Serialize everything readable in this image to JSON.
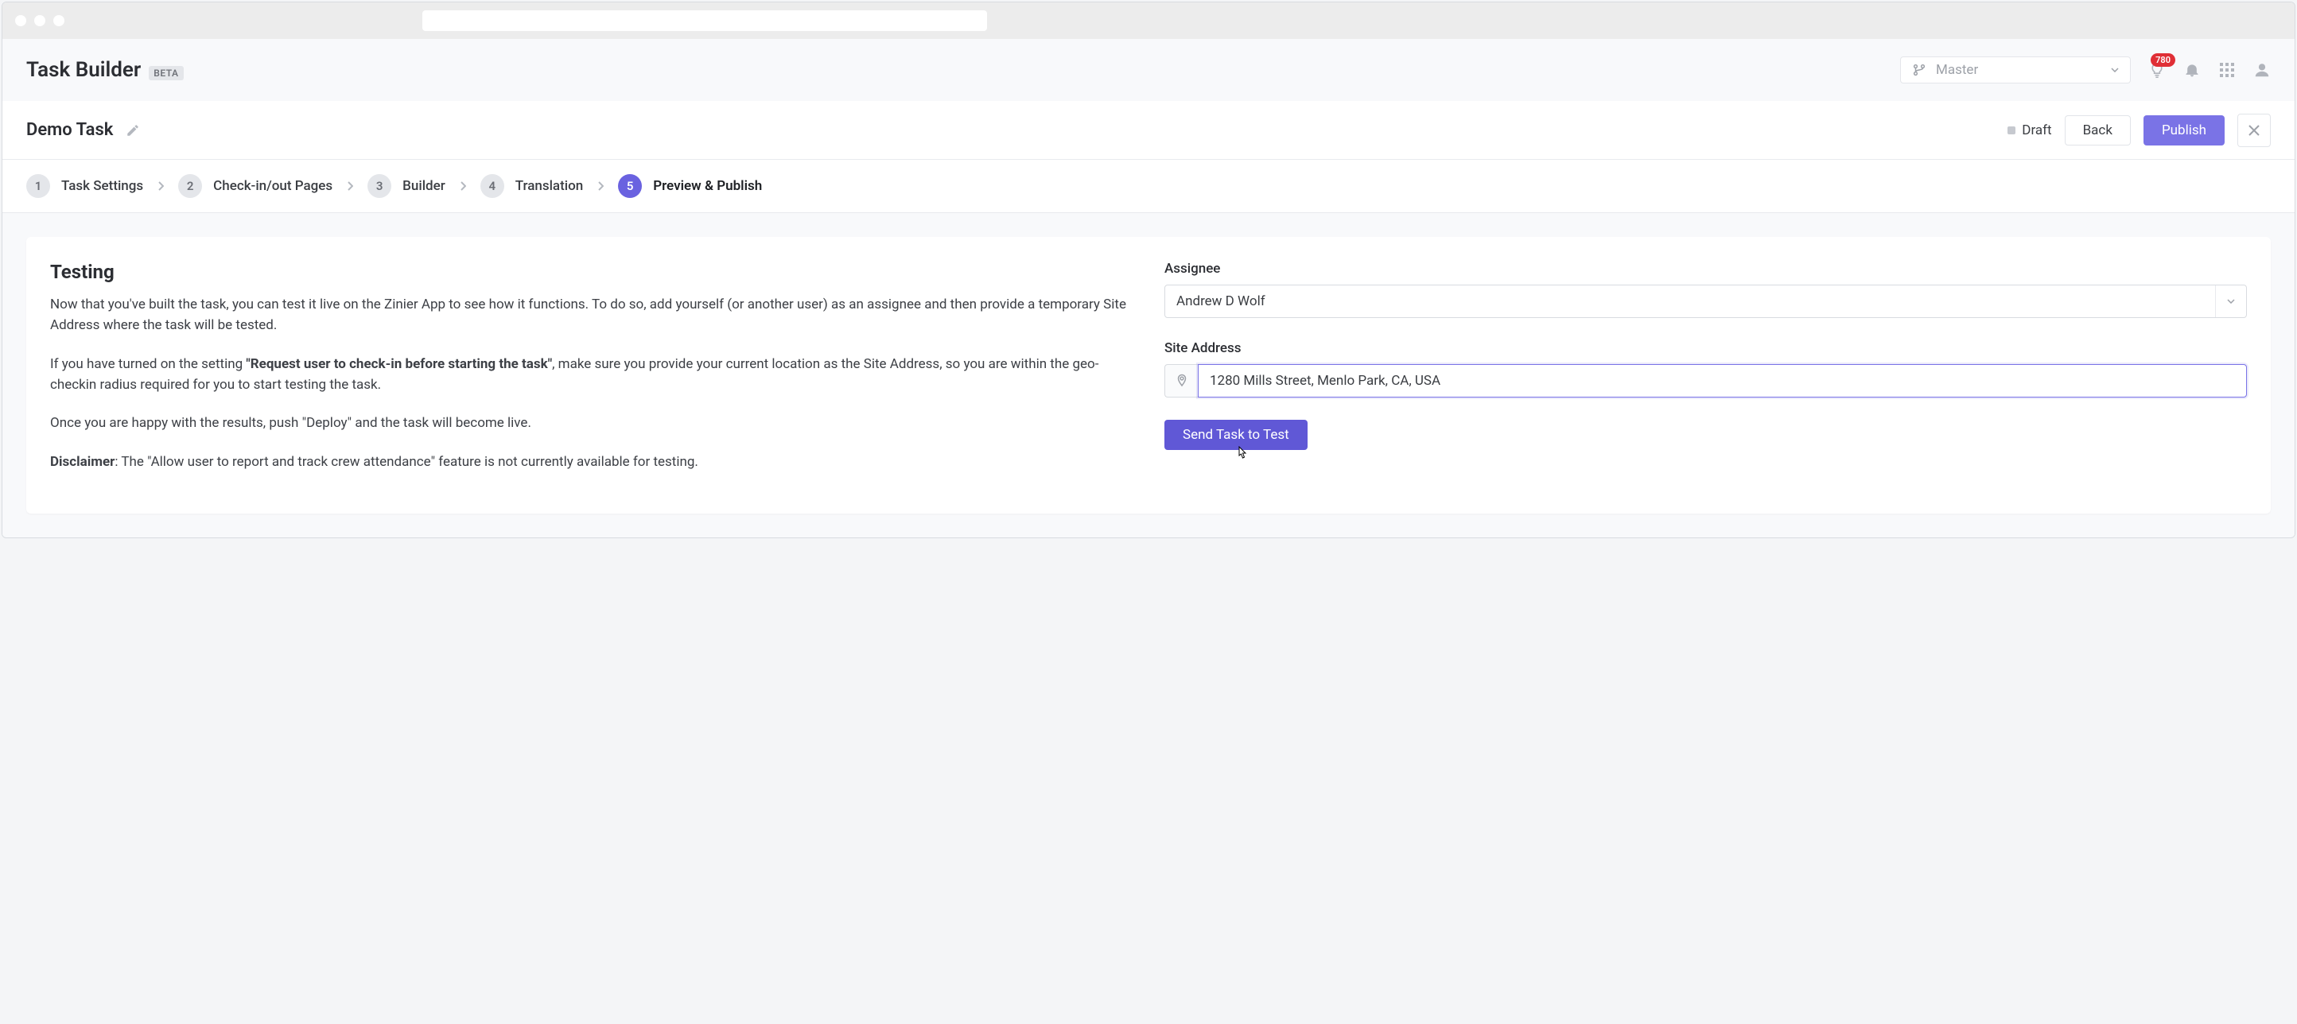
{
  "header": {
    "app_title": "Task Builder",
    "badge": "BETA",
    "branch_label": "Master",
    "notification_count": "780"
  },
  "taskbar": {
    "task_name": "Demo Task",
    "status": "Draft",
    "back_label": "Back",
    "publish_label": "Publish"
  },
  "stepper": {
    "steps": [
      {
        "num": "1",
        "label": "Task Settings"
      },
      {
        "num": "2",
        "label": "Check-in/out Pages"
      },
      {
        "num": "3",
        "label": "Builder"
      },
      {
        "num": "4",
        "label": "Translation"
      },
      {
        "num": "5",
        "label": "Preview & Publish"
      }
    ]
  },
  "testing": {
    "title": "Testing",
    "p1": "Now that you've built the task, you can test it live on the Zinier App to see how it functions. To do so, add yourself (or another user) as an assignee and then provide a temporary Site Address where the task will be tested.",
    "p2_before": "If you have turned on the setting ",
    "p2_bold": "\"Request user to check-in before starting the task\"",
    "p2_after": ", make sure you provide your current location as the Site Address, so you are within the geo-checkin radius required for you to start testing the task.",
    "p3": "Once you are happy with the results, push \"Deploy\" and the task will become live.",
    "p4_bold": "Disclaimer",
    "p4_after": ": The \"Allow user to report and track crew attendance\" feature is not currently available for testing."
  },
  "form": {
    "assignee_label": "Assignee",
    "assignee_value": "Andrew D Wolf",
    "site_label": "Site Address",
    "site_value": "1280 Mills Street, Menlo Park, CA, USA",
    "send_label": "Send Task to Test"
  }
}
